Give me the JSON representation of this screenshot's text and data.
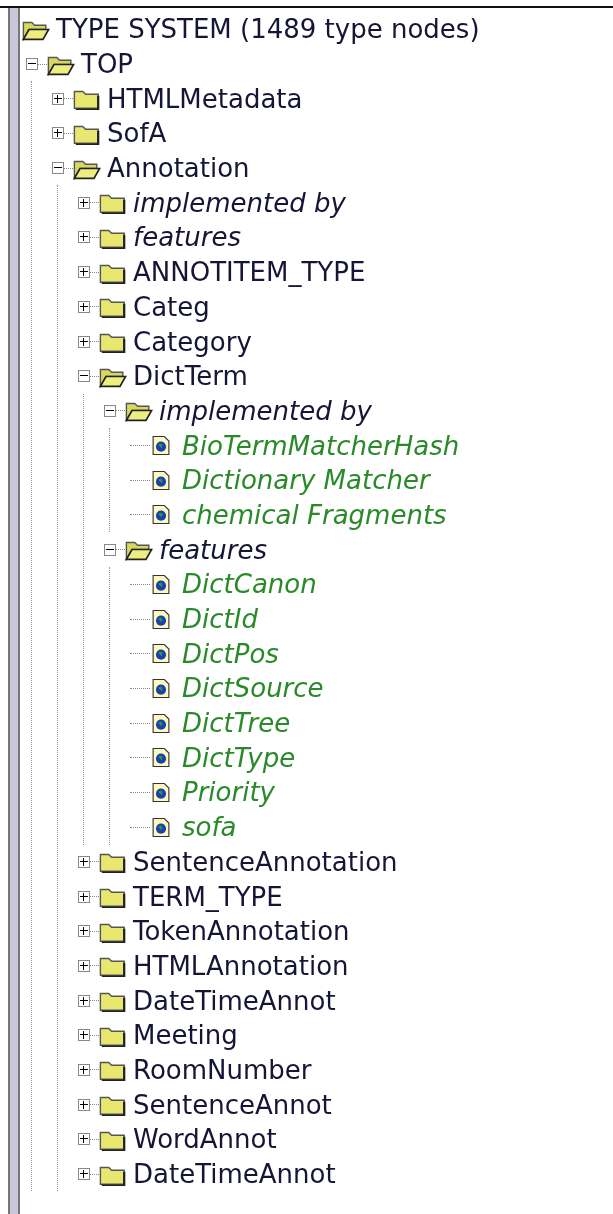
{
  "tree": {
    "label": "TYPE SYSTEM (1489 type nodes)",
    "kind": "type",
    "expanded": true,
    "children": [
      {
        "label": "TOP",
        "kind": "type",
        "expanded": true,
        "children": [
          {
            "label": "HTMLMetadata",
            "kind": "type",
            "expanded": false
          },
          {
            "label": "SofA",
            "kind": "type",
            "expanded": false
          },
          {
            "label": "Annotation",
            "kind": "type",
            "expanded": true,
            "children": [
              {
                "label": "implemented by",
                "kind": "group",
                "expanded": false
              },
              {
                "label": "features",
                "kind": "group",
                "expanded": false
              },
              {
                "label": "ANNOTITEM_TYPE",
                "kind": "type",
                "expanded": false
              },
              {
                "label": "Categ",
                "kind": "type",
                "expanded": false
              },
              {
                "label": "Category",
                "kind": "type",
                "expanded": false
              },
              {
                "label": "DictTerm",
                "kind": "type",
                "expanded": true,
                "children": [
                  {
                    "label": "implemented by",
                    "kind": "group",
                    "expanded": true,
                    "children": [
                      {
                        "label": "BioTermMatcherHash",
                        "kind": "item"
                      },
                      {
                        "label": "Dictionary Matcher",
                        "kind": "item"
                      },
                      {
                        "label": "chemical Fragments",
                        "kind": "item"
                      }
                    ]
                  },
                  {
                    "label": "features",
                    "kind": "group",
                    "expanded": true,
                    "children": [
                      {
                        "label": "DictCanon",
                        "kind": "item"
                      },
                      {
                        "label": "DictId",
                        "kind": "item"
                      },
                      {
                        "label": "DictPos",
                        "kind": "item"
                      },
                      {
                        "label": "DictSource",
                        "kind": "item"
                      },
                      {
                        "label": "DictTree",
                        "kind": "item"
                      },
                      {
                        "label": "DictType",
                        "kind": "item"
                      },
                      {
                        "label": "Priority",
                        "kind": "item"
                      },
                      {
                        "label": "sofa",
                        "kind": "item"
                      }
                    ]
                  }
                ]
              },
              {
                "label": "SentenceAnnotation",
                "kind": "type",
                "expanded": false
              },
              {
                "label": "TERM_TYPE",
                "kind": "type",
                "expanded": false
              },
              {
                "label": "TokenAnnotation",
                "kind": "type",
                "expanded": false
              },
              {
                "label": "HTMLAnnotation",
                "kind": "type",
                "expanded": false
              },
              {
                "label": "DateTimeAnnot",
                "kind": "type",
                "expanded": false
              },
              {
                "label": "Meeting",
                "kind": "type",
                "expanded": false
              },
              {
                "label": "RoomNumber",
                "kind": "type",
                "expanded": false
              },
              {
                "label": "SentenceAnnot",
                "kind": "type",
                "expanded": false
              },
              {
                "label": "WordAnnot",
                "kind": "type",
                "expanded": false
              },
              {
                "label": "DateTimeAnnot",
                "kind": "type",
                "expanded": false
              }
            ]
          }
        ]
      }
    ]
  }
}
